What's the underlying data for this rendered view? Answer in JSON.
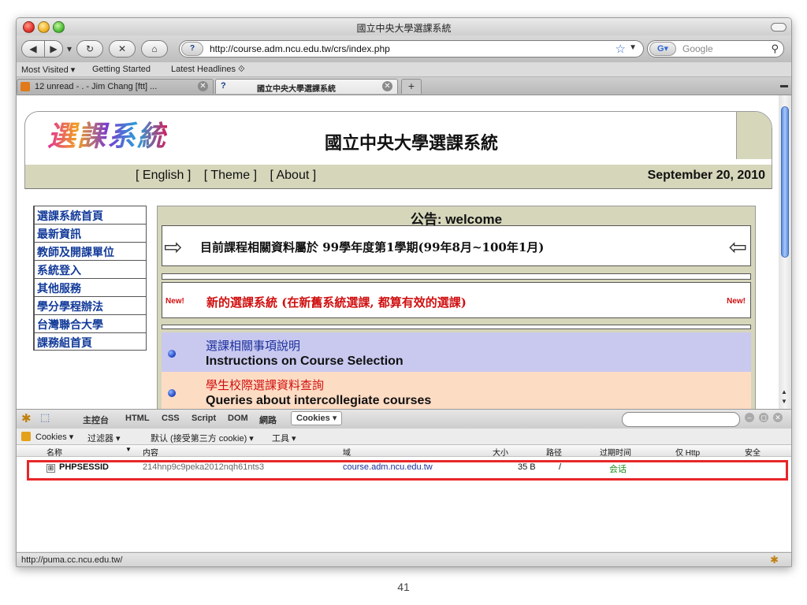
{
  "window": {
    "title": "國立中央大學選課系統"
  },
  "navigation": {
    "url": "http://course.adm.ncu.edu.tw/crs/index.php",
    "search_placeholder": "Google"
  },
  "bookmarks": [
    "Most Visited ▾",
    "Getting Started",
    "Latest Headlines ⟐"
  ],
  "tabs": [
    {
      "label": "12 unread - . - Jim Chang [ftt] ..."
    },
    {
      "label": "國立中央大學選課系統"
    }
  ],
  "page": {
    "logo_text": "選課系統",
    "site_title": "國立中央大學選課系統",
    "links": [
      "[ English ]",
      "[ Theme ]",
      "[ About ]"
    ],
    "date": "September 20, 2010",
    "side_menu": [
      "選課系統首頁",
      "最新資訊",
      "教師及開課單位",
      "系統登入",
      "其他服務",
      "學分學程辦法",
      "台灣聯合大學",
      "課務組首頁"
    ],
    "notice": {
      "title": "公告: welcome",
      "semester_line": "目前課程相關資料屬於 99學年度第1學期(99年8月~100年1月)",
      "new_badge": "New!",
      "new_system_line": "新的選課系統 (在新舊系統選課, 都算有效的選課)",
      "items": [
        {
          "zh": "選課相關事項說明",
          "en": "Instructions on Course Selection"
        },
        {
          "zh": "學生校際選課資料查詢",
          "en": "Queries about intercollegiate courses"
        }
      ]
    }
  },
  "firebug": {
    "tabs": [
      "主控台",
      "HTML",
      "CSS",
      "Script",
      "DOM",
      "網路"
    ],
    "active_tab": "Cookies ▾",
    "subtoolbar": [
      "Cookies ▾",
      "过滤器 ▾",
      "默认 (接受第三方 cookie) ▾",
      "工具 ▾"
    ],
    "columns": [
      "名称",
      "内容",
      "域",
      "大小",
      "路径",
      "过期时间",
      "仅 Http",
      "安全"
    ],
    "cookie": {
      "expander": "⊞",
      "name": "PHPSESSID",
      "value": "214hnp9c9peka2012nqh61nts3",
      "domain": "course.adm.ncu.edu.tw",
      "size": "35 B",
      "path": "/",
      "expires": "会话"
    }
  },
  "status_bar": {
    "text": "http://puma.cc.ncu.edu.tw/"
  },
  "slide": {
    "page_number": "41"
  },
  "colors": {
    "highlight": "#e8262a",
    "page_bar": "#d6d6bb",
    "link_blue": "#123a99"
  }
}
